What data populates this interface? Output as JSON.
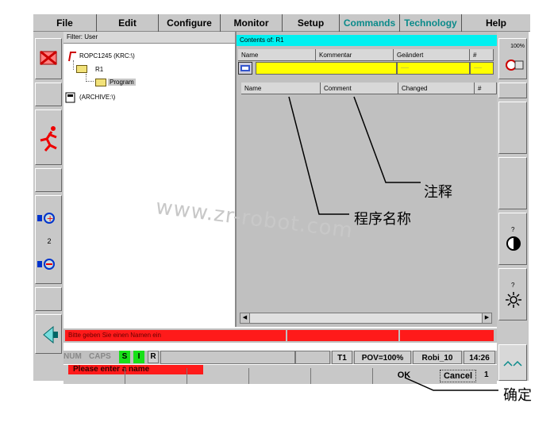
{
  "menu": [
    {
      "label": "File",
      "highlight": false
    },
    {
      "label": "Edit",
      "highlight": false
    },
    {
      "label": "Configure",
      "highlight": false
    },
    {
      "label": "Monitor",
      "highlight": false
    },
    {
      "label": "Setup",
      "highlight": false
    },
    {
      "label": "Commands",
      "highlight": true
    },
    {
      "label": "Technology",
      "highlight": true
    },
    {
      "label": "Help",
      "highlight": false
    }
  ],
  "left_pane": {
    "filter": "Filter: User",
    "tree": [
      "ROPC1245 (KRC:\\)",
      "R1",
      "Program",
      "(ARCHIVE:\\)"
    ]
  },
  "right_pane": {
    "title": "Contents of: R1",
    "headers": [
      "Name",
      "Kommentar",
      "Geändert",
      "#"
    ],
    "placeholders": [
      "-----",
      "-----"
    ],
    "list_headers": [
      "Name",
      "Comment",
      "Changed",
      "#"
    ]
  },
  "right_toolbar": {
    "zoom": "100%",
    "q1": "?",
    "q2": "?"
  },
  "left_toolbar": {
    "num": "2"
  },
  "message_bar": {
    "text": "Bitte geben Sie einen Namen ein",
    "color": "#ff1a1a"
  },
  "status": {
    "num": "NUM",
    "caps": "CAPS",
    "s": "S",
    "i": "I",
    "r": "R",
    "mode": "T1",
    "pov": "POV=100%",
    "robot": "Robi_10",
    "time": "14:26"
  },
  "prompt": "Please enter a name",
  "buttons": {
    "ok": "OK",
    "cancel": "Cancel",
    "cancel_num": "1"
  },
  "watermark": "www.zr-robot.com",
  "callouts": {
    "comment": "注释",
    "program_name": "程序名称",
    "confirm": "确定"
  },
  "colors": {
    "cyan": "#00f0f0",
    "yellow": "#ffff00",
    "red": "#ff1a1a",
    "green": "#18e018",
    "teal": "#0a8a8a",
    "gray": "#c8c8c8"
  }
}
